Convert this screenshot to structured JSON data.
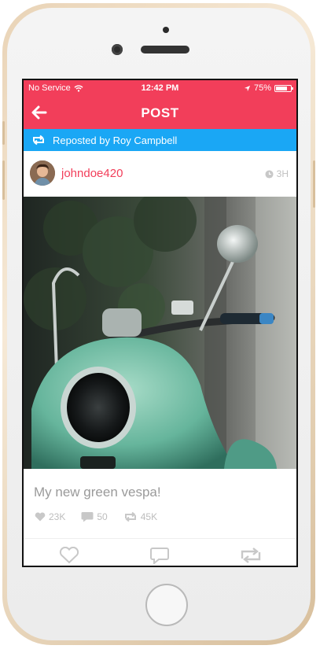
{
  "status_bar": {
    "carrier": "No Service",
    "time": "12:42 PM",
    "battery_percent": "75%",
    "battery_level": 0.75
  },
  "header": {
    "title": "POST",
    "back_icon": "arrow-left-icon"
  },
  "repost": {
    "text": "Reposted by Roy Campbell",
    "icon": "repost-icon"
  },
  "post": {
    "username": "johndoe420",
    "time_ago": "3H",
    "caption": "My new green vespa!",
    "likes": "23K",
    "comments": "50",
    "reposts": "45K"
  },
  "tab_bar": {
    "items": [
      "heart-icon",
      "comment-icon",
      "repost-icon"
    ]
  },
  "colors": {
    "accent": "#f23e5a",
    "repost_bar": "#1aa7f5",
    "muted": "#bdbdbd"
  }
}
